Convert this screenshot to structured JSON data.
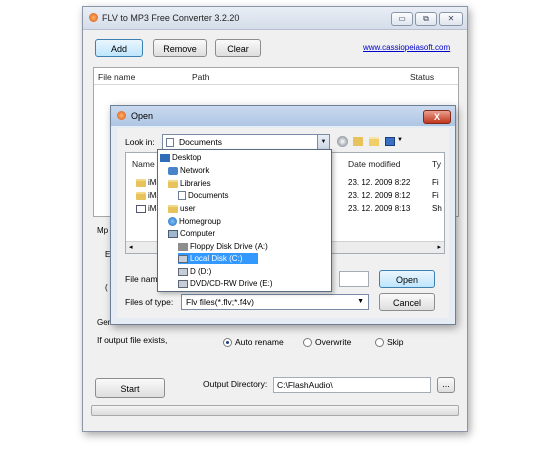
{
  "main": {
    "title": "FLV to MP3 Free Converter 3.2.20",
    "window_controls": {
      "minimize": "▭",
      "maximize": "⧉",
      "close": "✕"
    },
    "toolbar": {
      "add": "Add",
      "remove": "Remove",
      "clear": "Clear"
    },
    "website": "www.cassiopeiasoft.com",
    "columns": [
      "File name",
      "Path",
      "Status"
    ],
    "partial_labels": {
      "mp": "Mp",
      "e": "E",
      "paren": "("
    },
    "general_label": "General",
    "if_exists_label": "If output file exists,",
    "radio": {
      "auto_rename": "Auto rename",
      "overwrite": "Overwrite",
      "skip": "Skip"
    },
    "start": "Start",
    "output_dir_label": "Output Directory:",
    "output_dir_value": "C:\\FlashAudio\\",
    "browse": "..."
  },
  "open_dialog": {
    "title": "Open",
    "close": "X",
    "look_in_label": "Look in:",
    "look_in_value": "Documents",
    "columns": {
      "name": "Name",
      "date_modified": "Date modified",
      "type": "Ty"
    },
    "files": [
      {
        "name": "iMa",
        "date": "23. 12. 2009 8:22",
        "type": "Fi"
      },
      {
        "name": "iMa",
        "date": "23. 12. 2009 8:12",
        "type": "Fi"
      },
      {
        "name": "iMa",
        "date": "23. 12. 2009 8:13",
        "type": "Sh"
      }
    ],
    "file_name_label": "File name",
    "files_of_type_label": "Files of type:",
    "files_of_type_value": "Flv files(*.flv;*.f4v)",
    "open_button": "Open",
    "cancel_button": "Cancel",
    "dropdown_items": [
      {
        "label": "Desktop",
        "icon": "desktop-icon"
      },
      {
        "label": "Network",
        "icon": "network-icon"
      },
      {
        "label": "Libraries",
        "icon": "libraries-icon"
      },
      {
        "label": "Documents",
        "icon": "documents-icon"
      },
      {
        "label": "user",
        "icon": "user-icon"
      },
      {
        "label": "Homegroup",
        "icon": "homegroup-icon"
      },
      {
        "label": "Computer",
        "icon": "computer-icon"
      },
      {
        "label": "Floppy Disk Drive (A:)",
        "icon": "floppy-icon"
      },
      {
        "label": "Local Disk (C:)",
        "icon": "disk-icon",
        "selected": true
      },
      {
        "label": "D (D:)",
        "icon": "disk-icon"
      },
      {
        "label": "DVD/CD-RW Drive (E:)",
        "icon": "dvd-icon"
      }
    ]
  },
  "colors": {
    "accent": "#3399ff",
    "link": "#0000cc",
    "close_red": "#c2351c"
  }
}
